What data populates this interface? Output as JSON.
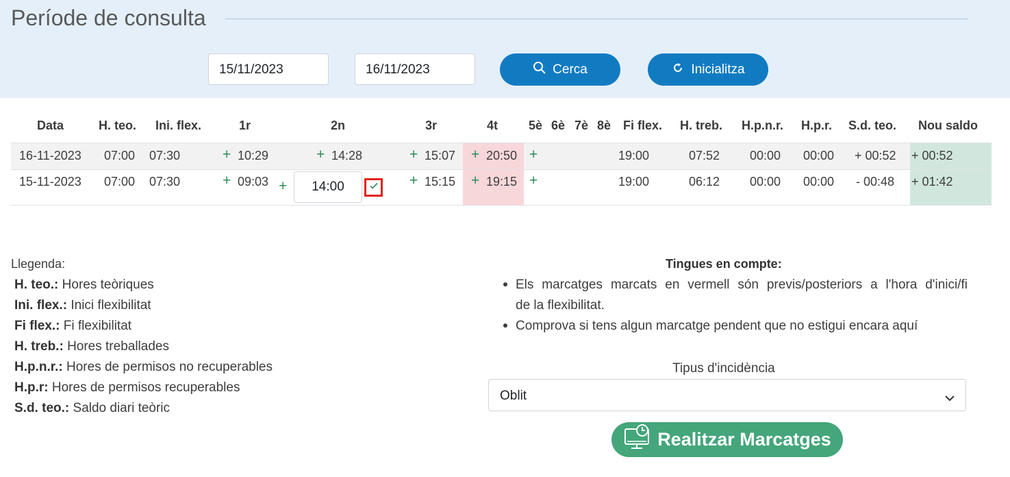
{
  "header": {
    "title": "Període de consulta",
    "date_from": "15/11/2023",
    "date_to": "16/11/2023",
    "search_label": "Cerca",
    "reset_label": "Inicialitza"
  },
  "table": {
    "columns": [
      "Data",
      "H. teo.",
      "Ini. flex.",
      "1r",
      "2n",
      "3r",
      "4t",
      "5è",
      "6è",
      "7è",
      "8è",
      "Fi flex.",
      "H. treb.",
      "H.p.n.r.",
      "H.p.r.",
      "S.d. teo.",
      "Nou saldo"
    ],
    "rows": [
      {
        "data": "16-11-2023",
        "hteo": "07:00",
        "iniflex": "07:30",
        "p1": "10:29",
        "p2": "14:28",
        "p3": "15:07",
        "p4": "20:50",
        "fiflex": "19:00",
        "htreb": "07:52",
        "hpnr": "00:00",
        "hpr": "00:00",
        "sdteo": "+ 00:52",
        "nousaldo": "+ 00:52"
      },
      {
        "data": "15-11-2023",
        "hteo": "07:00",
        "iniflex": "07:30",
        "p1": "09:03",
        "p2_edit": "14:00",
        "p3": "15:15",
        "p4": "19:15",
        "fiflex": "19:00",
        "htreb": "06:12",
        "hpnr": "00:00",
        "hpr": "00:00",
        "sdteo": "- 00:48",
        "nousaldo": "+ 01:42"
      }
    ],
    "plus_symbol": "+"
  },
  "legend": {
    "title": "Llegenda:",
    "items": [
      {
        "key": "H. teo.:",
        "desc": "Hores teòriques"
      },
      {
        "key": "Ini. flex.:",
        "desc": "Inici flexibilitat"
      },
      {
        "key": "Fi flex.:",
        "desc": "Fi flexibilitat"
      },
      {
        "key": "H. treb.:",
        "desc": "Hores treballades"
      },
      {
        "key": "H.p.n.r.:",
        "desc": "Hores de permisos no recuperables"
      },
      {
        "key": "H.p.r:",
        "desc": "Hores de permisos recuperables"
      },
      {
        "key": "S.d. teo.:",
        "desc": "Saldo diari teòric"
      }
    ]
  },
  "notes": {
    "title": "Tingues en compte:",
    "item1_line1": "Els marcatges marcats en vermell són previs/posteriors a l'hora d'inici/fi",
    "item1_line2": "de la flexibilitat.",
    "item2": "Comprova si tens algun marcatge pendent que no estigui encara aquí"
  },
  "incidence": {
    "label": "Tipus d'incidència",
    "selected": "Oblit"
  },
  "action": {
    "label": "Realitzar Marcatges"
  },
  "colors": {
    "header_band": "#e4eff9",
    "primary": "#117bc2",
    "late_cell": "#f8d7da",
    "balance_cell": "#d1e7dd",
    "action": "#44a67a",
    "plus": "#2e8b57",
    "highlight_border": "#e2231a"
  }
}
